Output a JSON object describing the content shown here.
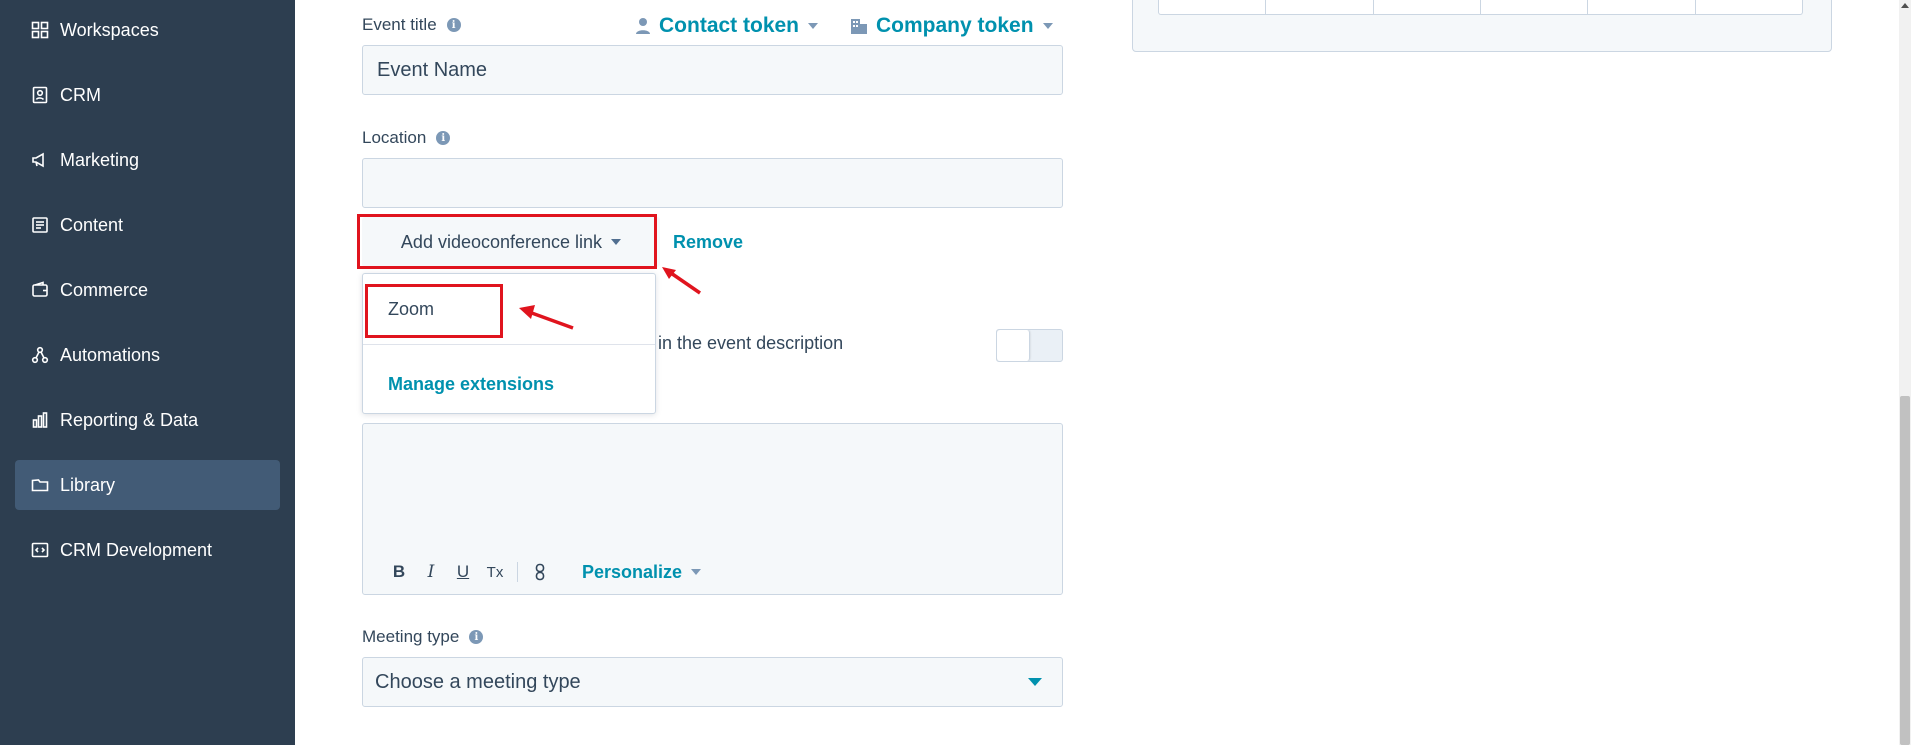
{
  "sidebar": {
    "items": [
      {
        "label": "Workspaces",
        "icon": "grid-icon"
      },
      {
        "label": "CRM",
        "icon": "contacts-icon"
      },
      {
        "label": "Marketing",
        "icon": "megaphone-icon"
      },
      {
        "label": "Content",
        "icon": "content-icon"
      },
      {
        "label": "Commerce",
        "icon": "wallet-icon"
      },
      {
        "label": "Automations",
        "icon": "automations-icon"
      },
      {
        "label": "Reporting & Data",
        "icon": "bar-chart-icon"
      },
      {
        "label": "Library",
        "icon": "folder-icon",
        "active": true
      },
      {
        "label": "CRM Development",
        "icon": "code-icon"
      }
    ]
  },
  "form": {
    "event_title": {
      "label": "Event title",
      "value": "Event Name"
    },
    "tokens": {
      "contact": "Contact token",
      "company": "Company token"
    },
    "location": {
      "label": "Location",
      "value": ""
    },
    "videoconference": {
      "button_label": "Add videoconference link",
      "remove_label": "Remove"
    },
    "dropdown": {
      "zoom": "Zoom",
      "manage": "Manage extensions"
    },
    "description_toggle_text": "in the event description",
    "editor": {
      "bold": "B",
      "italic": "I",
      "underline": "U",
      "clear_format": "Tx",
      "personalize": "Personalize"
    },
    "meeting_type": {
      "label": "Meeting type",
      "placeholder": "Choose a meeting type"
    }
  },
  "colors": {
    "sidebar_bg": "#2d3e50",
    "sidebar_active": "#425b76",
    "accent_teal": "#0091ae",
    "annotation_red": "#e0141e"
  }
}
